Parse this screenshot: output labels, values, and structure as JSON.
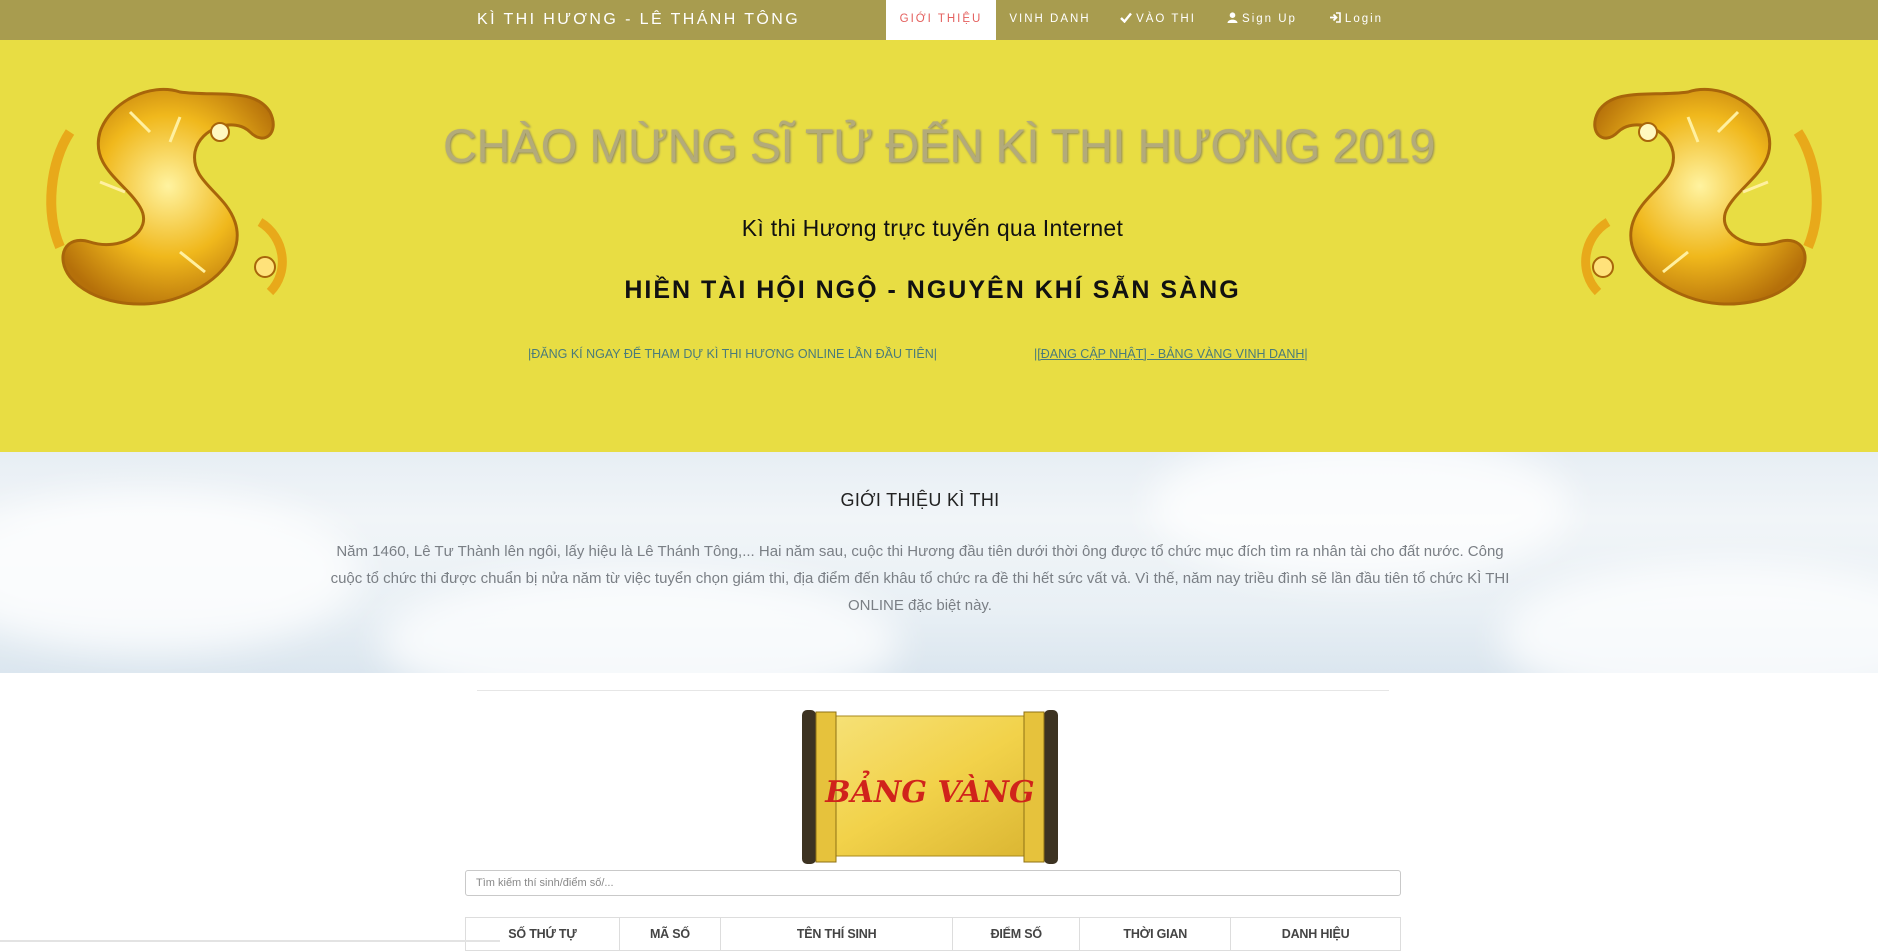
{
  "nav": {
    "brand": "KÌ THI HƯƠNG - LÊ THÁNH TÔNG",
    "items": [
      {
        "label": "GIỚI THIỆU",
        "icon": null,
        "active": true
      },
      {
        "label": "VINH DANH",
        "icon": null
      },
      {
        "label": "VÀO THI",
        "icon": "check-icon"
      },
      {
        "label": "Sign Up",
        "icon": "user-icon"
      },
      {
        "label": "Login",
        "icon": "login-icon"
      }
    ]
  },
  "hero": {
    "title": "CHÀO MỪNG SĨ TỬ ĐẾN KÌ THI HƯƠNG 2019",
    "subtitle": "Kì thi Hương trực tuyến qua Internet",
    "motto": "HIỀN TÀI HỘI NGỘ - NGUYÊN KHÍ SẴN SÀNG",
    "register_link": "|ĐĂNG KÍ NGAY ĐỂ THAM DỰ KÌ THI HƯƠNG ONLINE LẦN ĐẦU TIÊN|",
    "update_link": "|[ĐANG CẬP NHẬT] - BẢNG VÀNG VINH DANH|",
    "colors": {
      "background": "#e8dd43",
      "navbar": "#a89c4f",
      "active_tab_text": "#e4605e"
    }
  },
  "intro": {
    "heading": "GIỚI THIỆU KÌ THI",
    "text": "Năm 1460, Lê Tư Thành lên ngôi, lấy hiệu là Lê Thánh Tông,... Hai năm sau, cuộc thi Hương đầu tiên dưới thời ông được tổ chức mục đích tìm ra nhân tài cho đất nước. Công cuộc tổ chức thi được chuẩn bị nửa năm từ việc tuyển chọn giám thi, địa điểm đến khâu tổ chức ra đề thi hết sức vất vả. Vì thế, năm nay triều đình sẽ lần đầu tiên tổ chức KÌ THI ONLINE đặc biệt này."
  },
  "results": {
    "scroll_text": "BẢNG VÀNG",
    "search_placeholder": "Tìm kiếm thí sinh/điểm số/...",
    "columns": [
      "SỐ THỨ TỰ",
      "MÃ SỐ",
      "TÊN THÍ SINH",
      "ĐIỂM SỐ",
      "THỜI GIAN",
      "DANH HIỆU"
    ]
  }
}
